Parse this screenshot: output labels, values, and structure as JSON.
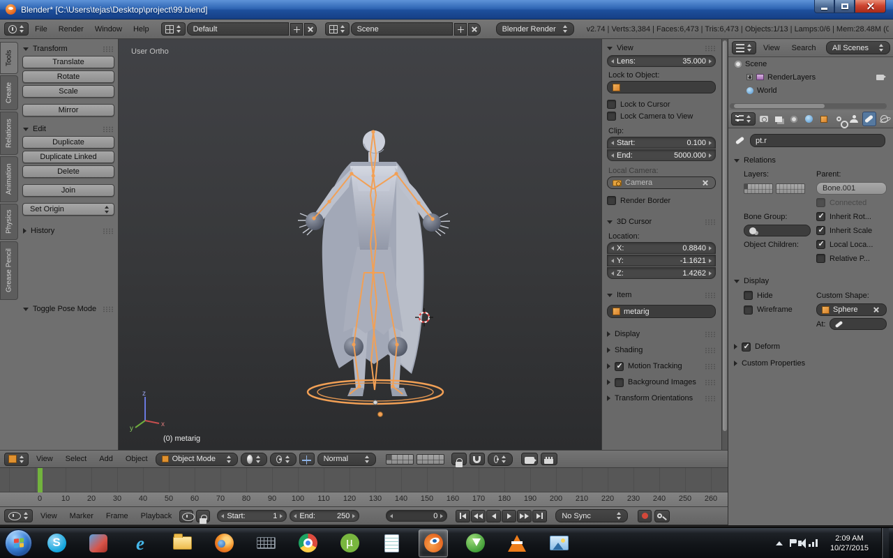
{
  "titlebar": {
    "title": "Blender* [C:\\Users\\tejas\\Desktop\\project\\99.blend]"
  },
  "header": {
    "menus": [
      "File",
      "Render",
      "Window",
      "Help"
    ],
    "layout": "Default",
    "scene": "Scene",
    "engine": "Blender Render",
    "stats": "v2.74 | Verts:3,384 | Faces:6,473 | Tris:6,473 | Objects:1/13 | Lamps:0/6 | Mem:28.48M (0."
  },
  "toolshelf": {
    "tabs": [
      "Tools",
      "Create",
      "Relations",
      "Animation",
      "Physics",
      "Grease Pencil"
    ],
    "transform_title": "Transform",
    "translate": "Translate",
    "rotate": "Rotate",
    "scale": "Scale",
    "mirror": "Mirror",
    "edit_title": "Edit",
    "duplicate": "Duplicate",
    "duplicate_linked": "Duplicate Linked",
    "delete": "Delete",
    "join": "Join",
    "set_origin": "Set Origin",
    "history_title": "History",
    "toggle_pose": "Toggle Pose Mode"
  },
  "viewport": {
    "view_label": "User Ortho",
    "object_label": "(0) metarig",
    "axis_z": "z",
    "axis_y": "y",
    "axis_x": "x"
  },
  "npanel": {
    "view_title": "View",
    "lens_label": "Lens:",
    "lens": "35.000",
    "lock_obj_label": "Lock to Object:",
    "lock_cursor": "Lock to Cursor",
    "lock_cam": "Lock Camera to View",
    "clip_label": "Clip:",
    "start_label": "Start:",
    "clip_start": "0.100",
    "end_label": "End:",
    "clip_end": "5000.000",
    "local_cam_label": "Local Camera:",
    "local_cam": "Camera",
    "render_border": "Render Border",
    "cursor_title": "3D Cursor",
    "location_label": "Location:",
    "x_label": "X:",
    "x": "0.8840",
    "y_label": "Y:",
    "y": "-1.1621",
    "z_label": "Z:",
    "z": "1.4262",
    "item_title": "Item",
    "item_name": "metarig",
    "display_title": "Display",
    "shading_title": "Shading",
    "motion_tracking": "Motion Tracking",
    "background_images": "Background Images",
    "transform_orientations": "Transform Orientations",
    "checks": {
      "lock_cursor": false,
      "lock_cam": false,
      "render_border": false,
      "motion_tracking": true,
      "background_images": false
    }
  },
  "outliner": {
    "menus": [
      "View",
      "Search"
    ],
    "mode": "All Scenes",
    "scene": "Scene",
    "renderlayers": "RenderLayers",
    "world": "World"
  },
  "props": {
    "name": "pt.r",
    "relations_title": "Relations",
    "layers_label": "Layers:",
    "parent_label": "Parent:",
    "parent": "Bone.001",
    "connected": "Connected",
    "bone_group_label": "Bone Group:",
    "inherit_rot": "Inherit Rot...",
    "inherit_scale": "Inherit Scale",
    "object_children": "Object Children:",
    "local_loc": "Local Loca...",
    "relative_p": "Relative P...",
    "display_title": "Display",
    "hide": "Hide",
    "wireframe": "Wireframe",
    "custom_shape_label": "Custom Shape:",
    "custom_shape": "Sphere",
    "at_label": "At:",
    "deform_title": "Deform",
    "custom_props_title": "Custom Properties",
    "checks": {
      "connected": false,
      "inherit_rot": true,
      "inherit_scale": true,
      "local_loc": true,
      "relative_p": false,
      "hide": false,
      "wireframe": false,
      "deform": true
    }
  },
  "vheader": {
    "menus": [
      "View",
      "Select",
      "Add",
      "Object"
    ],
    "mode": "Object Mode",
    "orientation": "Normal"
  },
  "timeline": {
    "ticks": [
      "0",
      "10",
      "20",
      "30",
      "40",
      "50",
      "60",
      "70",
      "80",
      "90",
      "100",
      "110",
      "120",
      "130",
      "140",
      "150",
      "160",
      "170",
      "180",
      "190",
      "200",
      "210",
      "220",
      "230",
      "240",
      "250",
      "260"
    ],
    "menus": [
      "View",
      "Marker",
      "Frame",
      "Playback"
    ],
    "start_label": "Start:",
    "start": "1",
    "end_label": "End:",
    "end": "250",
    "current": "0",
    "sync": "No Sync"
  },
  "taskbar": {
    "time": "2:09 AM",
    "date": "10/27/2015"
  }
}
